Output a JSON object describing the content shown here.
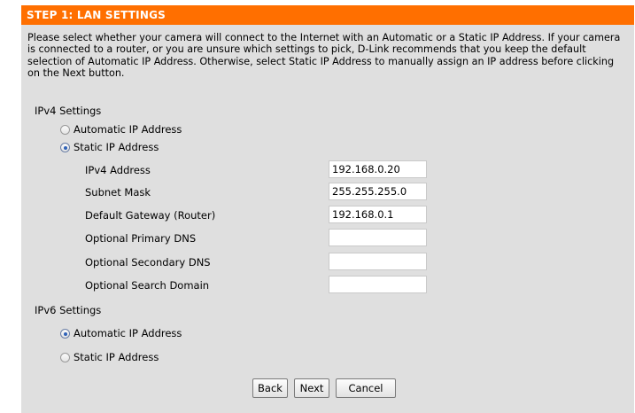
{
  "header": {
    "title": "STEP 1: LAN SETTINGS"
  },
  "description": "Please select whether your camera will connect to the Internet with an Automatic or a Static IP Address. If your camera is connected to a router, or you are unsure which settings to pick, D-Link recommends that you keep the default selection of Automatic IP Address. Otherwise, select Static IP Address to manually assign an IP address before clicking on the Next button.",
  "ipv4": {
    "heading": "IPv4 Settings",
    "automatic_label": "Automatic IP Address",
    "static_label": "Static IP Address",
    "selected": "static",
    "fields": [
      {
        "label": "IPv4 Address",
        "value": "192.168.0.20"
      },
      {
        "label": "Subnet Mask",
        "value": "255.255.255.0"
      },
      {
        "label": "Default Gateway (Router)",
        "value": "192.168.0.1"
      },
      {
        "label": "Optional Primary DNS",
        "value": ""
      },
      {
        "label": "Optional Secondary DNS",
        "value": ""
      },
      {
        "label": "Optional Search Domain",
        "value": ""
      }
    ]
  },
  "ipv6": {
    "heading": "IPv6 Settings",
    "automatic_label": "Automatic IP Address",
    "static_label": "Static IP Address",
    "selected": "automatic"
  },
  "buttons": {
    "back": "Back",
    "next": "Next",
    "cancel": "Cancel"
  },
  "colors": {
    "header_bg": "#ff6f00",
    "panel_bg": "#dfdfdf",
    "header_text": "#ffffff"
  }
}
